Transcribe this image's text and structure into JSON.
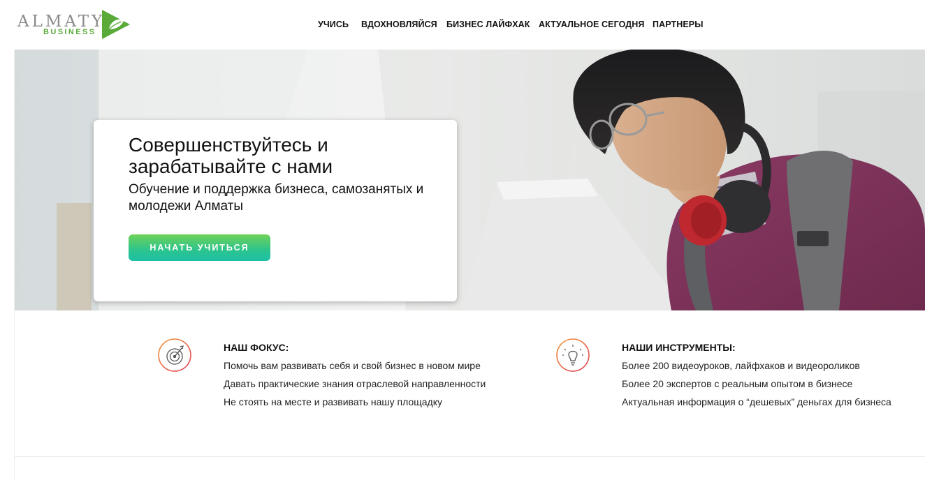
{
  "brand": {
    "name": "ALMATY",
    "tagline": "BUSINESS",
    "accent": "#5aaa3a"
  },
  "nav": {
    "items": [
      {
        "label": "УЧИСЬ"
      },
      {
        "label": "ВДОХНОВЛЯЙСЯ"
      },
      {
        "label": "БИЗНЕС ЛАЙФХАК"
      },
      {
        "label": "АКТУАЛЬНОЕ СЕГОДНЯ"
      },
      {
        "label": "ПАРТНЕРЫ"
      }
    ]
  },
  "hero": {
    "title": "Совершенствуйтесь и зарабатывайте с нами",
    "subtitle": "Обучение и поддержка бизнеса, самозанятых и молодежи Алматы",
    "cta_label": "НАЧАТЬ УЧИТЬСЯ",
    "cta_gradient": [
      "#6fd25a",
      "#1ec0a6"
    ]
  },
  "features": [
    {
      "icon": "target-icon",
      "title": "НАШ ФОКУС:",
      "items": [
        "Помочь вам развивать себя и свой бизнес в новом мире",
        "Давать практические знания отраслевой направленности",
        "Не стоять на месте и развивать нашу площадку"
      ]
    },
    {
      "icon": "lightbulb-icon",
      "title": "НАШИ ИНСТРУМЕНТЫ:",
      "items": [
        "Более 200 видеоуроков, лайфхаков и видеороликов",
        "Более 20 экспертов с реальным опытом в бизнесе",
        "Актуальная информация о “дешевых” деньгах для бизнеса"
      ]
    }
  ]
}
